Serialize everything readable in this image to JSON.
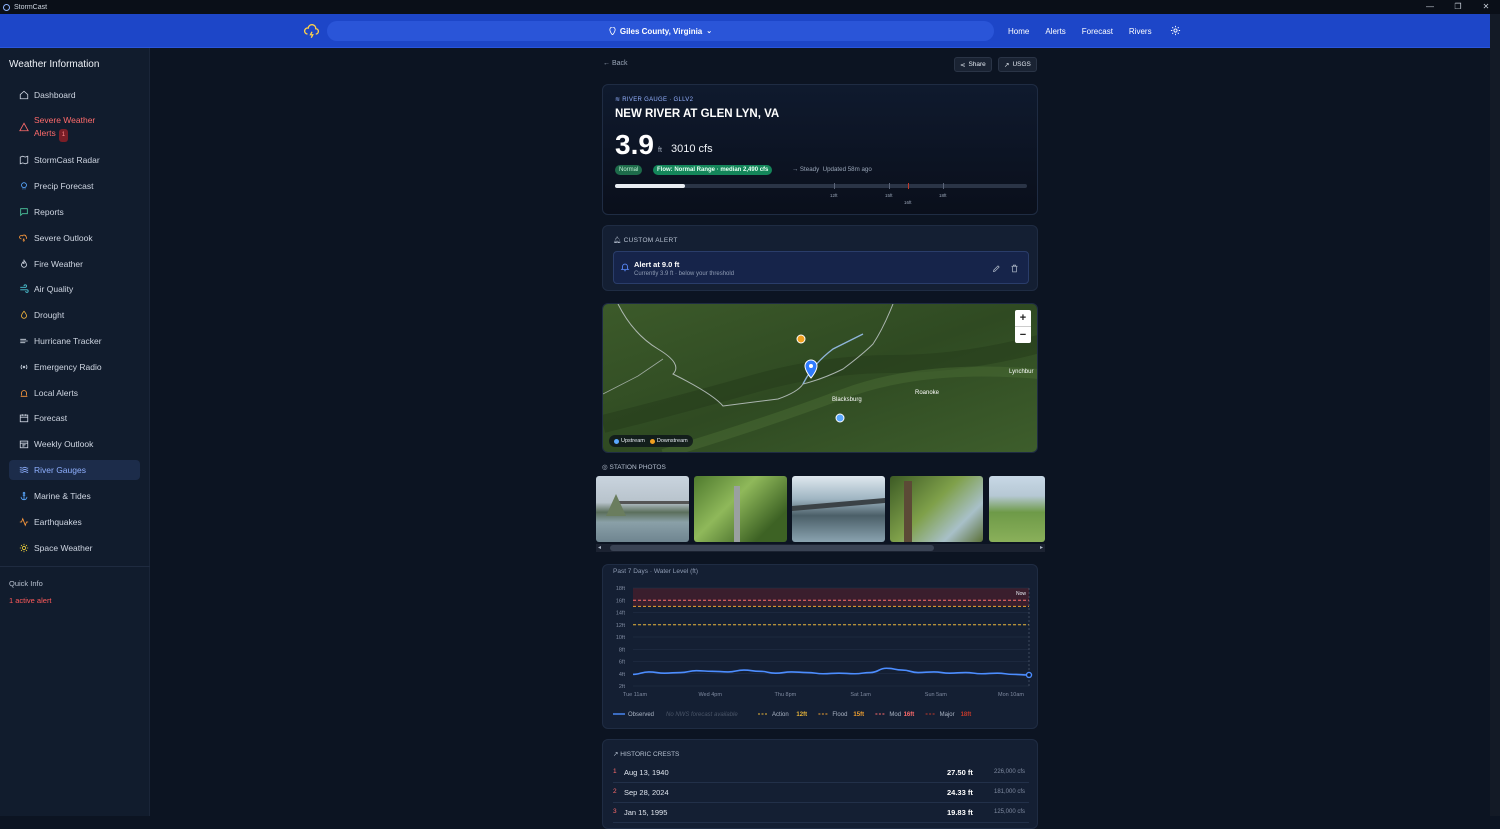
{
  "window": {
    "title": "StormCast",
    "controls": [
      "—",
      "❐",
      "✕"
    ]
  },
  "topnav": {
    "location": "Giles County, Virginia",
    "links": [
      "Home",
      "Alerts",
      "Forecast",
      "Rivers"
    ]
  },
  "sidebar": {
    "title": "Weather Information",
    "items": [
      {
        "label": "Dashboard",
        "icon": "home-icon"
      },
      {
        "label": "Severe Weather Alerts",
        "badge": "1",
        "icon": "warning-icon"
      },
      {
        "label": "StormCast Radar",
        "icon": "map-icon"
      },
      {
        "label": "Precip Forecast",
        "icon": "rain-icon"
      },
      {
        "label": "Reports",
        "icon": "chat-icon"
      },
      {
        "label": "Severe Outlook",
        "icon": "storm-icon"
      },
      {
        "label": "Fire Weather",
        "icon": "flame-icon"
      },
      {
        "label": "Air Quality",
        "icon": "wind-icon"
      },
      {
        "label": "Drought",
        "icon": "drop-icon"
      },
      {
        "label": "Hurricane Tracker",
        "icon": "hurricane-icon"
      },
      {
        "label": "Emergency Radio",
        "icon": "radio-icon"
      },
      {
        "label": "Local Alerts",
        "icon": "siren-icon"
      },
      {
        "label": "Forecast",
        "icon": "calendar-icon"
      },
      {
        "label": "Weekly Outlook",
        "icon": "calendar-week-icon"
      },
      {
        "label": "River Gauges",
        "icon": "waves-icon"
      },
      {
        "label": "Marine & Tides",
        "icon": "anchor-icon"
      },
      {
        "label": "Earthquakes",
        "icon": "activity-icon"
      },
      {
        "label": "Space Weather",
        "icon": "sun-icon"
      }
    ],
    "quick_info_label": "Quick Info",
    "quick_info_alert": "1 active alert"
  },
  "page": {
    "back_label": "Back",
    "share_label": "Share",
    "usgs_label": "USGS"
  },
  "gauge": {
    "kicker": "RIVER GAUGE · GLLV2",
    "name": "NEW RIVER AT GLEN LYN, VA",
    "stage": "3.9",
    "stage_unit": "ft",
    "flow": "3010 cfs",
    "status": "Normal",
    "flow_status": "Flow: Normal Range · median 2,490 cfs",
    "trend": "→ Steady",
    "updated": "Updated 58m ago",
    "level_fraction": 0.17,
    "ticks": [
      "12ft",
      "15ft",
      "16ft",
      "18ft"
    ]
  },
  "custom_alert": {
    "header": "CUSTOM ALERT",
    "title": "Alert at 9.0 ft",
    "subtitle": "Currently 3.9 ft · below your threshold"
  },
  "map": {
    "labels": [
      "Blacksburg",
      "Roanoke",
      "Lynchbur"
    ],
    "legend": [
      "Upstream",
      "Downstream"
    ],
    "zoom_in": "+",
    "zoom_out": "−"
  },
  "photos": {
    "header": "STATION PHOTOS"
  },
  "chart_data": {
    "type": "line",
    "title": "Past 7 Days · Water Level (ft)",
    "ylim": [
      2,
      18
    ],
    "yticks": [
      "18ft",
      "16ft",
      "14ft",
      "12ft",
      "10ft",
      "8ft",
      "6ft",
      "4ft",
      "2ft"
    ],
    "xticks": [
      "Tue 11am",
      "Wed 4pm",
      "Thu 8pm",
      "Sat 1am",
      "Sun 5am",
      "Mon 10am"
    ],
    "series": [
      {
        "name": "Observed",
        "values": [
          3.9,
          4.3,
          4.1,
          4.2,
          4.5,
          4.4,
          4.3,
          4.6,
          4.4,
          4.1,
          4.3,
          4.2,
          4.0,
          4.1,
          4.0,
          4.2,
          4.9,
          4.6,
          4.2,
          4.3,
          4.1,
          4.2,
          4.0,
          4.1,
          3.9,
          3.8
        ]
      }
    ],
    "thresholds": [
      {
        "name": "Action",
        "value": 12,
        "label": "12ft",
        "color": "#e8b53a"
      },
      {
        "name": "Flood",
        "value": 15,
        "label": "15ft",
        "color": "#f0a030"
      },
      {
        "name": "Mod",
        "value": 16,
        "label": "16ft",
        "color": "#ff6b6b"
      },
      {
        "name": "Major",
        "value": 18,
        "label": "18ft",
        "color": "#c0392b"
      }
    ],
    "forecast_note": "No NWS forecast available",
    "now_label": "Now"
  },
  "crests": {
    "header": "HISTORIC CRESTS",
    "rows": [
      {
        "rank": "1",
        "date": "Aug 13, 1940",
        "ft": "27.50 ft",
        "cfs": "226,000 cfs"
      },
      {
        "rank": "2",
        "date": "Sep 28, 2024",
        "ft": "24.33 ft",
        "cfs": "181,000 cfs"
      },
      {
        "rank": "3",
        "date": "Jan 15, 1995",
        "ft": "19.83 ft",
        "cfs": "125,000 cfs"
      }
    ]
  },
  "colors": {
    "accent": "#1d46c8",
    "alert": "#ff5a5a",
    "active_nav": "#8fb0ff"
  }
}
